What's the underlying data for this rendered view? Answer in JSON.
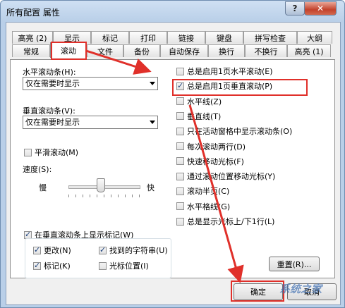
{
  "window": {
    "title": "所有配置 属性",
    "help_label": "?",
    "close_label": "✕"
  },
  "tabs_back": [
    "高亮 (2)",
    "显示",
    "标记",
    "打印",
    "链接",
    "键盘",
    "拼写检查",
    "大纲"
  ],
  "tabs_front": [
    "常规",
    "滚动",
    "文件",
    "备份",
    "自动保存",
    "换行",
    "不换行",
    "高亮 (1)"
  ],
  "left": {
    "hscroll_label": "水平滚动条(H):",
    "hscroll_value": "仅在需要时显示",
    "vscroll_label": "垂直滚动条(V):",
    "vscroll_value": "仅在需要时显示",
    "smooth_label": "平滑滚动(M)",
    "speed_label": "速度(S):",
    "slow_label": "慢",
    "fast_label": "快",
    "speed_level": 0.45,
    "marks_label": "在垂直滚动条上显示标记(W)",
    "marks_items": [
      {
        "label": "更改(N)",
        "checked": true
      },
      {
        "label": "找到的字符串(U)",
        "checked": true
      },
      {
        "label": "标记(K)",
        "checked": true
      },
      {
        "label": "光标位置(I)",
        "checked": false
      }
    ]
  },
  "right": {
    "options": [
      {
        "label": "总是启用1页水平滚动(E)",
        "checked": false
      },
      {
        "label": "总是启用1页垂直滚动(P)",
        "checked": true
      },
      {
        "label": "水平线(Z)",
        "checked": false
      },
      {
        "label": "垂直线(T)",
        "checked": false
      },
      {
        "label": "只在活动窗格中显示滚动条(O)",
        "checked": false
      },
      {
        "label": "每次滚动两行(D)",
        "checked": false
      },
      {
        "label": "快速移动光标(F)",
        "checked": false
      },
      {
        "label": "通过滚动位置移动光标(Y)",
        "checked": false
      },
      {
        "label": "滚动半页(C)",
        "checked": false
      },
      {
        "label": "水平格线(G)",
        "checked": false
      },
      {
        "label": "总是显示光标上/下1行(L)",
        "checked": false
      }
    ],
    "reset_label": "重置(R)..."
  },
  "footer": {
    "ok_label": "确定",
    "cancel_label": "取消"
  },
  "watermark": "系统之家",
  "colors": {
    "annotation": "#e0302a"
  }
}
